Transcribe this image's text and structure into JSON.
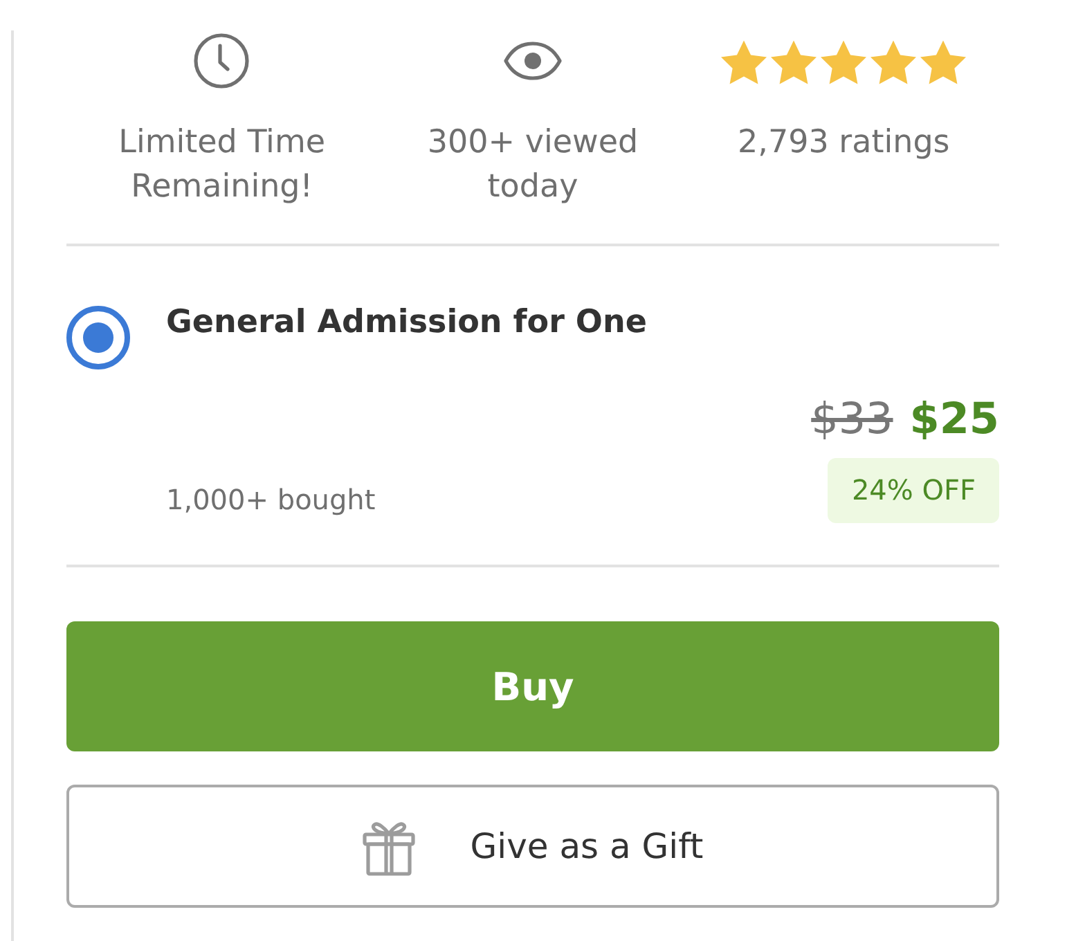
{
  "stats": [
    {
      "kind": "clock",
      "label": "Limited Time Remaining!"
    },
    {
      "kind": "eye",
      "label": "300+ viewed today"
    },
    {
      "kind": "stars",
      "stars": 5,
      "label": "2,793 ratings"
    }
  ],
  "options": [
    {
      "title": "General Admission for One",
      "selected": true,
      "original_price": "$33",
      "price": "$25",
      "discount": "24% OFF",
      "bought": "1,000+ bought"
    }
  ],
  "buttons": [
    {
      "kind": "primary",
      "label": "Buy"
    },
    {
      "kind": "gift",
      "label": "Give as a Gift"
    }
  ]
}
